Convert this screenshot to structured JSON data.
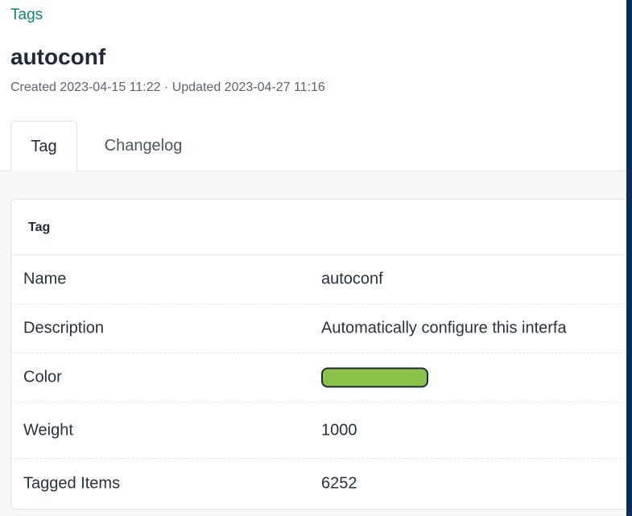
{
  "breadcrumb": {
    "label": "Tags"
  },
  "header": {
    "title": "autoconf",
    "meta": "Created 2023-04-15 11:22 · Updated 2023-04-27 11:16"
  },
  "tabs": [
    {
      "label": "Tag",
      "active": true
    },
    {
      "label": "Changelog",
      "active": false
    }
  ],
  "card": {
    "title": "Tag",
    "rows": [
      {
        "label": "Name",
        "value": "autoconf"
      },
      {
        "label": "Description",
        "value": "Automatically configure this interfa"
      },
      {
        "label": "Color",
        "value": "",
        "color": "#8bc34a"
      },
      {
        "label": "Weight",
        "value": "1000"
      },
      {
        "label": "Tagged Items",
        "value": "6252"
      }
    ]
  },
  "colors": {
    "link": "#14807d",
    "sidebar_strip": "#0b2e59",
    "tag_color": "#8bc34a"
  }
}
